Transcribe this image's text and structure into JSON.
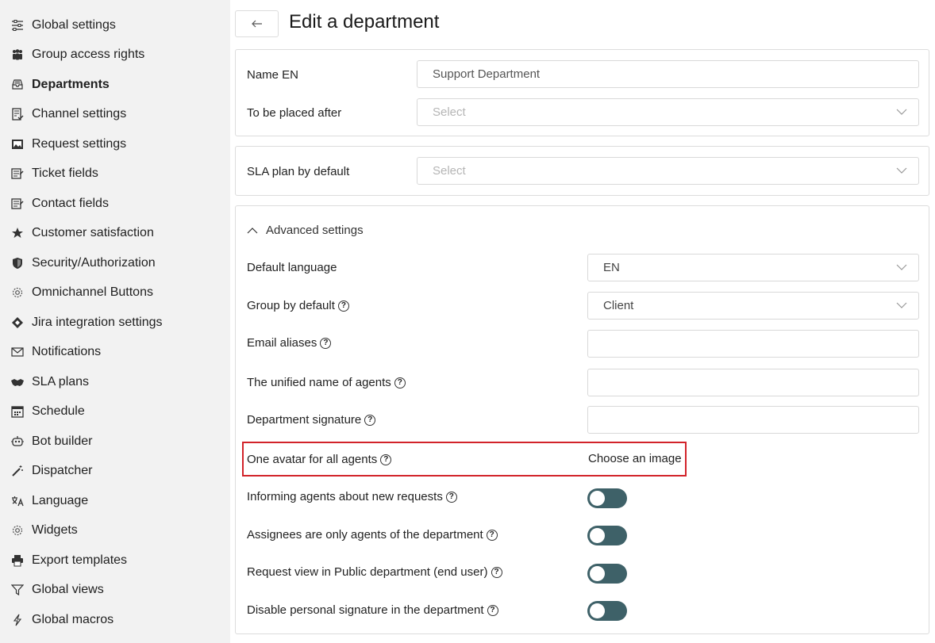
{
  "sidebar": {
    "items": [
      {
        "label": "Global settings",
        "icon": "sliders-icon"
      },
      {
        "label": "Group access rights",
        "icon": "users-group-icon"
      },
      {
        "label": "Departments",
        "icon": "inbox-icon",
        "active": true
      },
      {
        "label": "Channel settings",
        "icon": "checklist-icon"
      },
      {
        "label": "Request settings",
        "icon": "image-box-icon"
      },
      {
        "label": "Ticket fields",
        "icon": "form-fields-icon"
      },
      {
        "label": "Contact fields",
        "icon": "form-fields-icon"
      },
      {
        "label": "Customer satisfaction",
        "icon": "star-icon"
      },
      {
        "label": "Security/Authorization",
        "icon": "shield-icon"
      },
      {
        "label": "Omnichannel Buttons",
        "icon": "gear-icon"
      },
      {
        "label": "Jira integration settings",
        "icon": "jira-icon"
      },
      {
        "label": "Notifications",
        "icon": "envelope-icon"
      },
      {
        "label": "SLA plans",
        "icon": "handshake-icon"
      },
      {
        "label": "Schedule",
        "icon": "calendar-icon"
      },
      {
        "label": "Bot builder",
        "icon": "robot-icon"
      },
      {
        "label": "Dispatcher",
        "icon": "magic-wand-icon"
      },
      {
        "label": "Language",
        "icon": "language-icon"
      },
      {
        "label": "Widgets",
        "icon": "gear-icon"
      },
      {
        "label": "Export templates",
        "icon": "printer-icon"
      },
      {
        "label": "Global views",
        "icon": "filter-icon"
      },
      {
        "label": "Global macros",
        "icon": "lightning-icon"
      }
    ]
  },
  "header": {
    "back_icon": "arrow-left-icon",
    "title": "Edit a department"
  },
  "form": {
    "name_label": "Name EN",
    "name_value": "Support Department",
    "placed_after_label": "To be placed after",
    "placed_after_placeholder": "Select",
    "sla_label": "SLA plan by default",
    "sla_placeholder": "Select"
  },
  "advanced": {
    "toggle_label": "Advanced settings",
    "default_language_label": "Default language",
    "default_language_value": "EN",
    "group_by_label": "Group by default",
    "group_by_value": "Client",
    "email_aliases_label": "Email aliases",
    "unified_name_label": "The unified name of agents",
    "signature_label": "Department signature",
    "avatar_label": "One avatar for all agents",
    "choose_image": "Choose an image",
    "toggles": [
      {
        "label": "Informing agents about new requests",
        "on": false
      },
      {
        "label": "Assignees are only agents of the department",
        "on": false
      },
      {
        "label": "Request view in Public department (end user)",
        "on": false
      },
      {
        "label": "Disable personal signature in the department",
        "on": false
      }
    ]
  },
  "colors": {
    "toggle_track": "#3e6168",
    "highlight": "#d2232a",
    "sidebar_bg": "#f2f2f2"
  }
}
